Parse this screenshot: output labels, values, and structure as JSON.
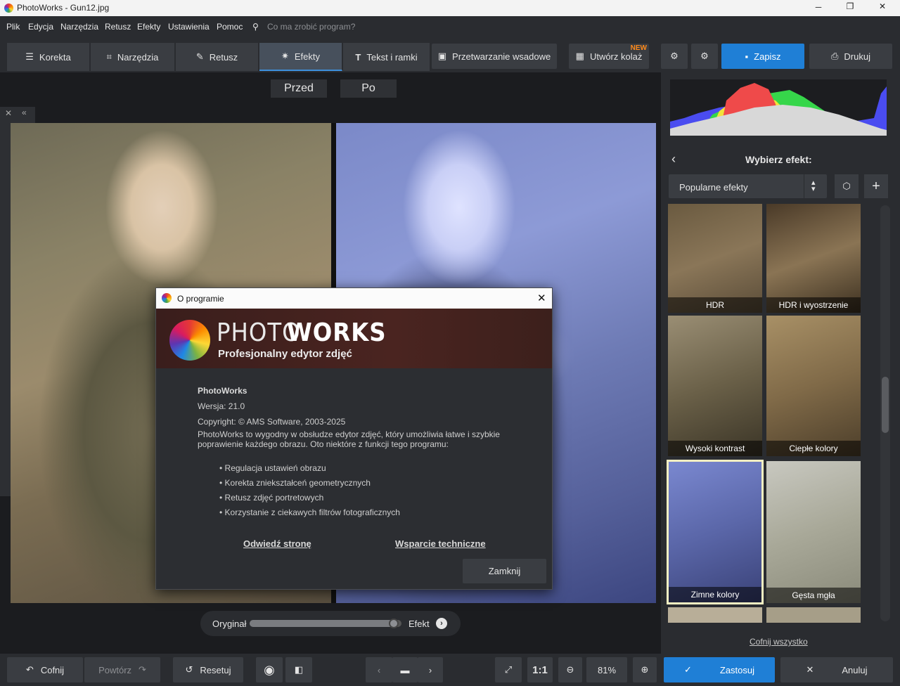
{
  "window": {
    "title": "PhotoWorks - Gun12.jpg"
  },
  "menu": {
    "items": [
      "Plik",
      "Edycja",
      "Narzędzia",
      "Retusz",
      "Efekty",
      "Ustawienia",
      "Pomoc"
    ],
    "search_placeholder": "Co ma zrobić program?"
  },
  "toolbar": {
    "tabs": [
      "Korekta",
      "Narzędzia",
      "Retusz",
      "Efekty",
      "Tekst i ramki"
    ],
    "batch": "Przetwarzanie wsadowe",
    "collage": "Utwórz kolaż",
    "new_badge": "NEW",
    "save": "Zapisz",
    "print": "Drukuj"
  },
  "view": {
    "before": "Przed",
    "after": "Po"
  },
  "slider": {
    "left": "Oryginał",
    "right": "Efekt",
    "value": 0.98
  },
  "panel": {
    "title": "Wybierz efekt:",
    "category": "Popularne efekty",
    "effects": [
      "HDR",
      "HDR i wyostrzenie",
      "Wysoki kontrast",
      "Ciepłe kolory",
      "Zimne kolory",
      "Gęsta mgła"
    ],
    "selected": "Zimne kolory",
    "undo_all": "Cofnij wszystko"
  },
  "bottom": {
    "undo": "Cofnij",
    "redo": "Powtórz",
    "reset": "Resetuj",
    "ratio": "1:1",
    "zoom": "81%",
    "apply": "Zastosuj",
    "cancel": "Anuluj"
  },
  "dialog": {
    "title": "O programie",
    "brand_a": "PHOTO",
    "brand_b": "WORKS",
    "brand_sub": "Profesjonalny edytor zdjęć",
    "app": "PhotoWorks",
    "version": "Wersja: 21.0",
    "copyright": "Copyright: © AMS Software, 2003-2025",
    "desc1": "PhotoWorks to wygodny w obsłudze edytor zdjęć, który umożliwia łatwe i szybkie",
    "desc2": "poprawienie każdego obrazu. Oto niektóre z funkcji tego programu:",
    "features": [
      "• Regulacja ustawień obrazu",
      "• Korekta zniekształceń geometrycznych",
      "• Retusz zdjęć portretowych",
      "• Korzystanie z ciekawych filtrów fotograficznych"
    ],
    "link_site": "Odwiedź stronę",
    "link_support": "Wsparcie techniczne",
    "close": "Zamknij"
  },
  "colors": {
    "accent": "#1f7fd6",
    "selected_border": "#f3efc2",
    "new_badge": "#ff8a1a"
  }
}
